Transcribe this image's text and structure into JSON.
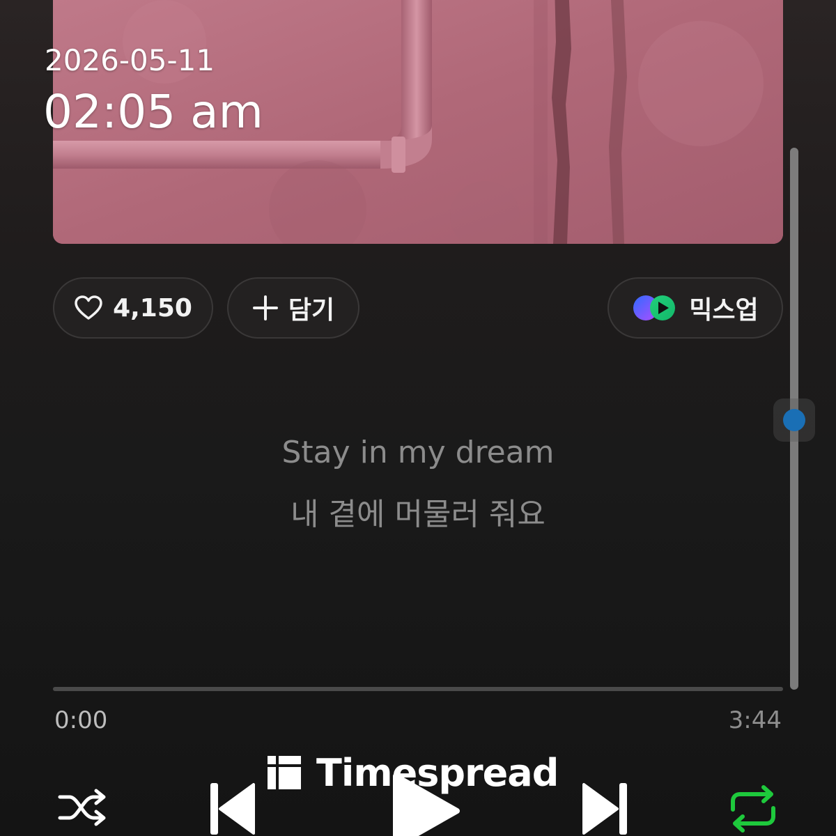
{
  "overlay": {
    "date": "2026-05-11",
    "time": "02:05 am"
  },
  "album_art": {
    "dominant_color": "#b26a7c"
  },
  "actions": {
    "like_count": "4,150",
    "add_label": "담기",
    "mixup_label": "믹스업"
  },
  "lyrics": {
    "line_1": "Stay in my dream",
    "line_2": "내 곁에 머물러 줘요"
  },
  "playback": {
    "current_time": "0:00",
    "total_time": "3:44",
    "progress_fraction": 0
  },
  "controls": {
    "shuffle_icon": "shuffle-icon",
    "prev_icon": "skip-previous-icon",
    "play_icon": "play-icon",
    "next_icon": "skip-next-icon",
    "repeat_icon": "repeat-icon",
    "repeat_color": "#1ec93c"
  },
  "scrollbar": {
    "thumb_color": "#1a6fb5"
  },
  "watermark": {
    "text": "Timespread"
  }
}
